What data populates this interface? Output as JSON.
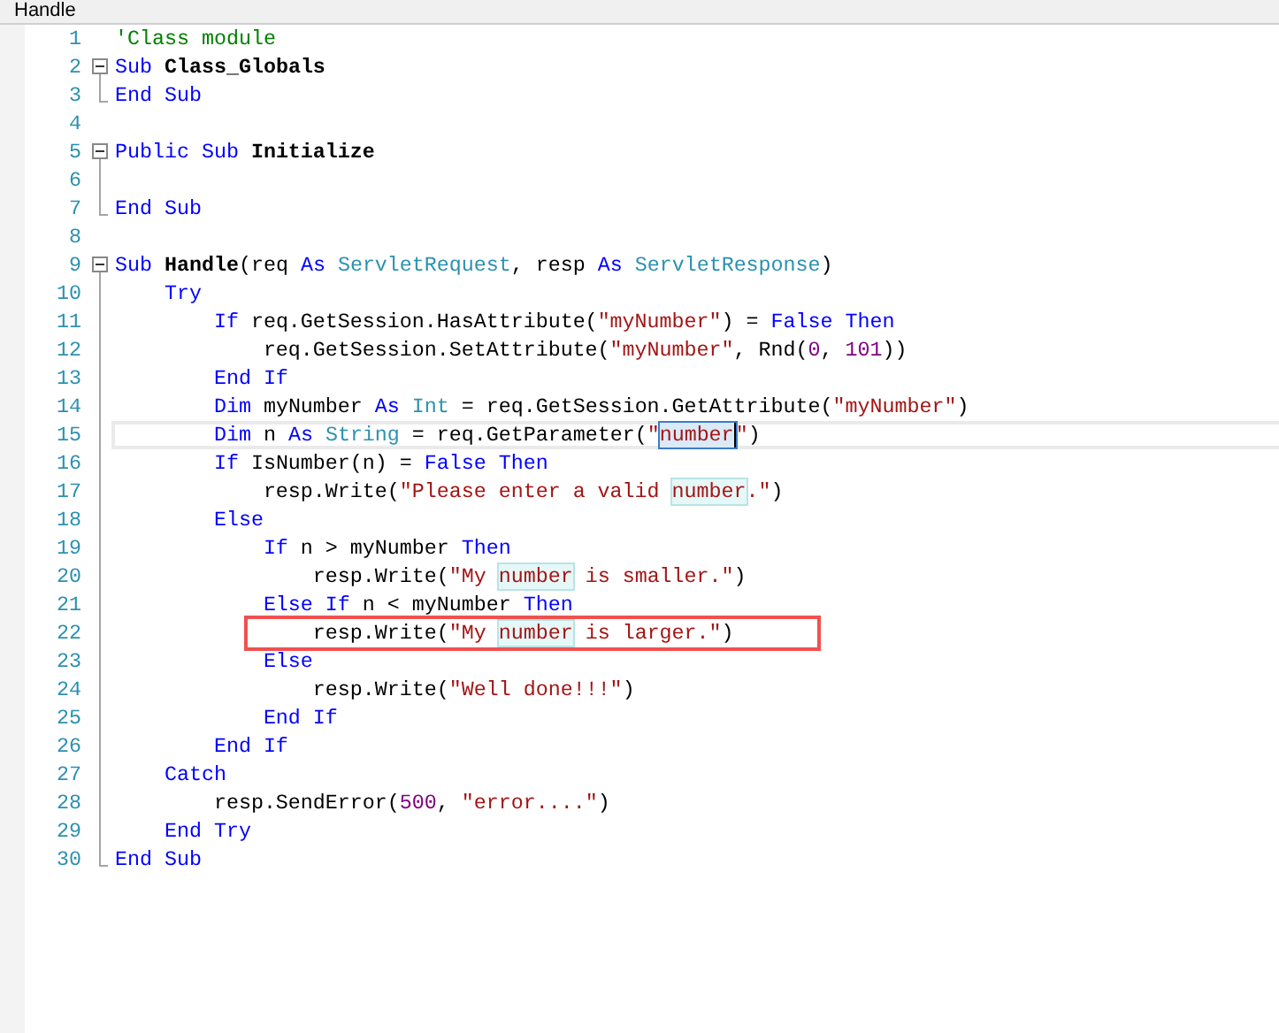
{
  "window": {
    "title": "Handle"
  },
  "lines": [
    {
      "number": "1",
      "kind": "plain",
      "tokens": [
        {
          "kind": "comment",
          "text": "'Class module"
        }
      ]
    },
    {
      "number": "2",
      "kind": "block-start",
      "tokens": [
        {
          "kind": "keyword",
          "text": "Sub"
        },
        {
          "kind": "name",
          "text": " Class_Globals"
        }
      ]
    },
    {
      "number": "3",
      "kind": "block-end",
      "tokens": [
        {
          "kind": "keyword",
          "text": "End Sub"
        }
      ]
    },
    {
      "number": "4",
      "kind": "plain"
    },
    {
      "number": "5",
      "kind": "block-start",
      "tokens": [
        {
          "kind": "keyword",
          "text": "Public Sub"
        },
        {
          "kind": "name",
          "text": " Initialize"
        }
      ]
    },
    {
      "number": "6",
      "kind": "block-body"
    },
    {
      "number": "7",
      "kind": "block-end",
      "tokens": [
        {
          "kind": "keyword",
          "text": "End Sub"
        }
      ]
    },
    {
      "number": "8",
      "kind": "plain"
    },
    {
      "number": "9",
      "kind": "block-start",
      "tokens": [
        {
          "kind": "keyword",
          "text": "Sub"
        },
        {
          "kind": "name",
          "text": " Handle"
        },
        {
          "kind": "plain",
          "text": "(req "
        },
        {
          "kind": "keyword",
          "text": "As"
        },
        {
          "kind": "type",
          "text": " ServletRequest"
        },
        {
          "kind": "plain",
          "text": ", resp "
        },
        {
          "kind": "keyword",
          "text": "As"
        },
        {
          "kind": "type",
          "text": " ServletResponse"
        },
        {
          "kind": "plain",
          "text": ")"
        }
      ]
    },
    {
      "number": "10",
      "kind": "block-body",
      "tokens": [
        {
          "kind": "keyword",
          "text": "    Try"
        }
      ]
    },
    {
      "number": "11",
      "kind": "block-body",
      "tokens": [
        {
          "kind": "keyword",
          "text": "        If"
        },
        {
          "kind": "plain",
          "text": " req.GetSession.HasAttribute("
        },
        {
          "kind": "string",
          "text": "\"myNumber\""
        },
        {
          "kind": "plain",
          "text": ") = "
        },
        {
          "kind": "keyword",
          "text": "False Then"
        }
      ]
    },
    {
      "number": "12",
      "kind": "block-body",
      "tokens": [
        {
          "kind": "plain",
          "text": "            req.GetSession.SetAttribute("
        },
        {
          "kind": "string",
          "text": "\"myNumber\""
        },
        {
          "kind": "plain",
          "text": ", Rnd("
        },
        {
          "kind": "number",
          "text": "0"
        },
        {
          "kind": "plain",
          "text": ", "
        },
        {
          "kind": "number",
          "text": "101"
        },
        {
          "kind": "plain",
          "text": "))"
        }
      ]
    },
    {
      "number": "13",
      "kind": "block-body",
      "tokens": [
        {
          "kind": "keyword",
          "text": "        End If"
        }
      ]
    },
    {
      "number": "14",
      "kind": "block-body",
      "tokens": [
        {
          "kind": "keyword",
          "text": "        Dim"
        },
        {
          "kind": "plain",
          "text": " myNumber "
        },
        {
          "kind": "keyword",
          "text": "As"
        },
        {
          "kind": "type",
          "text": " Int"
        },
        {
          "kind": "plain",
          "text": " = req.GetSession.GetAttribute("
        },
        {
          "kind": "string",
          "text": "\"myNumber\""
        },
        {
          "kind": "plain",
          "text": ")"
        }
      ]
    },
    {
      "number": "15",
      "kind": "block-body",
      "current": true,
      "tokens": [
        {
          "kind": "keyword",
          "text": "        Dim"
        },
        {
          "kind": "plain",
          "text": " n "
        },
        {
          "kind": "keyword",
          "text": "As"
        },
        {
          "kind": "type",
          "text": " String"
        },
        {
          "kind": "plain",
          "text": " = req.GetParameter("
        },
        {
          "kind": "string",
          "text": "\""
        },
        {
          "kind": "selection",
          "text": "number"
        },
        {
          "kind": "string",
          "text": "\""
        },
        {
          "kind": "plain",
          "text": ")"
        }
      ]
    },
    {
      "number": "16",
      "kind": "block-body",
      "tokens": [
        {
          "kind": "keyword",
          "text": "        If"
        },
        {
          "kind": "plain",
          "text": " IsNumber(n) = "
        },
        {
          "kind": "keyword",
          "text": "False Then"
        }
      ]
    },
    {
      "number": "17",
      "kind": "block-body",
      "tokens": [
        {
          "kind": "plain",
          "text": "            resp.Write("
        },
        {
          "kind": "string",
          "text": "\"Please enter a valid "
        },
        {
          "kind": "match",
          "text": "number"
        },
        {
          "kind": "string",
          "text": ".\""
        },
        {
          "kind": "plain",
          "text": ")"
        }
      ]
    },
    {
      "number": "18",
      "kind": "block-body",
      "tokens": [
        {
          "kind": "keyword",
          "text": "        Else"
        }
      ]
    },
    {
      "number": "19",
      "kind": "block-body",
      "tokens": [
        {
          "kind": "keyword",
          "text": "            If"
        },
        {
          "kind": "plain",
          "text": " n > myNumber "
        },
        {
          "kind": "keyword",
          "text": "Then"
        }
      ]
    },
    {
      "number": "20",
      "kind": "block-body",
      "tokens": [
        {
          "kind": "plain",
          "text": "                resp.Write("
        },
        {
          "kind": "string",
          "text": "\"My "
        },
        {
          "kind": "match",
          "text": "number"
        },
        {
          "kind": "string",
          "text": " is smaller.\""
        },
        {
          "kind": "plain",
          "text": ")"
        }
      ]
    },
    {
      "number": "21",
      "kind": "block-body",
      "tokens": [
        {
          "kind": "keyword",
          "text": "            Else If"
        },
        {
          "kind": "plain",
          "text": " n < myNumber "
        },
        {
          "kind": "keyword",
          "text": "Then"
        }
      ]
    },
    {
      "number": "22",
      "kind": "block-body",
      "annotated": true,
      "tokens": [
        {
          "kind": "plain",
          "text": "                resp.Write("
        },
        {
          "kind": "string",
          "text": "\"My "
        },
        {
          "kind": "match",
          "text": "number"
        },
        {
          "kind": "string",
          "text": " is larger.\""
        },
        {
          "kind": "plain",
          "text": ")"
        }
      ]
    },
    {
      "number": "23",
      "kind": "block-body",
      "tokens": [
        {
          "kind": "keyword",
          "text": "            Else"
        }
      ]
    },
    {
      "number": "24",
      "kind": "block-body",
      "tokens": [
        {
          "kind": "plain",
          "text": "                resp.Write("
        },
        {
          "kind": "string",
          "text": "\"Well done!!!\""
        },
        {
          "kind": "plain",
          "text": ")"
        }
      ]
    },
    {
      "number": "25",
      "kind": "block-body",
      "tokens": [
        {
          "kind": "keyword",
          "text": "            End If"
        }
      ]
    },
    {
      "number": "26",
      "kind": "block-body",
      "tokens": [
        {
          "kind": "keyword",
          "text": "        End If"
        }
      ]
    },
    {
      "number": "27",
      "kind": "block-body",
      "tokens": [
        {
          "kind": "keyword",
          "text": "    Catch"
        }
      ]
    },
    {
      "number": "28",
      "kind": "block-body",
      "tokens": [
        {
          "kind": "plain",
          "text": "        resp.SendError("
        },
        {
          "kind": "number",
          "text": "500"
        },
        {
          "kind": "plain",
          "text": ", "
        },
        {
          "kind": "string",
          "text": "\"error....\""
        },
        {
          "kind": "plain",
          "text": ")"
        }
      ]
    },
    {
      "number": "29",
      "kind": "block-body",
      "tokens": [
        {
          "kind": "keyword",
          "text": "    End Try"
        }
      ]
    },
    {
      "number": "30",
      "kind": "block-end",
      "tokens": [
        {
          "kind": "keyword",
          "text": "End Sub"
        }
      ]
    }
  ]
}
